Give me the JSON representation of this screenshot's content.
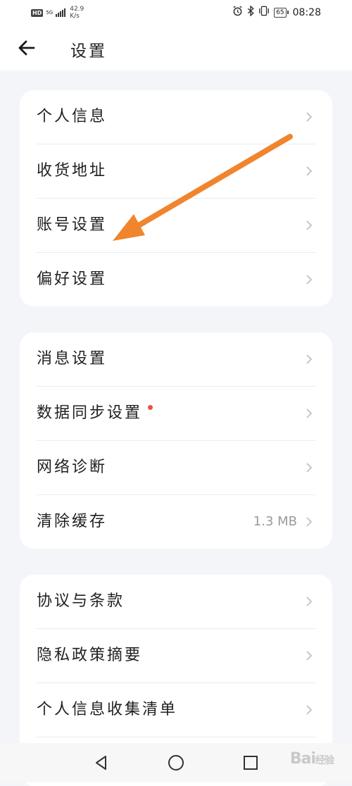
{
  "status_bar": {
    "hd": "HD",
    "network": "5G",
    "speed_value": "42.9",
    "speed_unit": "K/s",
    "battery": "65",
    "time": "08:28"
  },
  "header": {
    "title": "设置"
  },
  "groups": [
    {
      "items": [
        {
          "label": "个人信息"
        },
        {
          "label": "收货地址"
        },
        {
          "label": "账号设置"
        },
        {
          "label": "偏好设置"
        }
      ]
    },
    {
      "items": [
        {
          "label": "消息设置"
        },
        {
          "label": "数据同步设置",
          "badge": "red-dot"
        },
        {
          "label": "网络诊断"
        },
        {
          "label": "清除缓存",
          "value": "1.3 MB"
        }
      ]
    },
    {
      "items": [
        {
          "label": "协议与条款"
        },
        {
          "label": "隐私政策摘要"
        },
        {
          "label": "个人信息收集清单"
        }
      ]
    }
  ],
  "annotation": {
    "color": "#f0852e",
    "points_to": "账号设置"
  },
  "nav_bar": {
    "buttons": [
      "back-triangle-icon",
      "home-circle-icon",
      "recents-square-icon"
    ]
  },
  "watermark": {
    "text": "Bai",
    "sub": "经验"
  },
  "colors": {
    "background": "#f4f5f9",
    "card": "#ffffff",
    "red_dot": "#e8553f",
    "value_text": "#9a9a9a"
  }
}
